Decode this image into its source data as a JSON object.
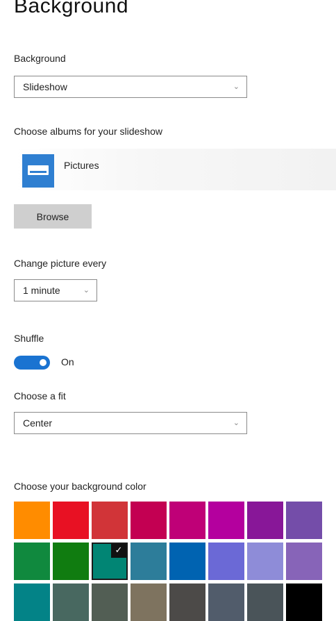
{
  "page": {
    "title": "Background"
  },
  "background": {
    "label": "Background",
    "value": "Slideshow"
  },
  "albums": {
    "label": "Choose albums for your slideshow",
    "items": [
      {
        "name": "Pictures",
        "icon": "folder-pictures-icon"
      }
    ]
  },
  "browse": {
    "label": "Browse"
  },
  "interval": {
    "label": "Change picture every",
    "value": "1 minute"
  },
  "shuffle": {
    "label": "Shuffle",
    "state": "On",
    "on": true
  },
  "fit": {
    "label": "Choose a fit",
    "value": "Center"
  },
  "color": {
    "label": "Choose your background color",
    "selected_index": 10,
    "swatches": [
      "#ff8c00",
      "#e81123",
      "#d13438",
      "#c30052",
      "#bf0077",
      "#b4009e",
      "#881798",
      "#744da9",
      "#10893e",
      "#107c10",
      "#018574",
      "#2d7d9a",
      "#0063b1",
      "#6b69d6",
      "#8e8cd8",
      "#8764b8",
      "#038387",
      "#486860",
      "#525e54",
      "#7e735f",
      "#4c4a48",
      "#515c6b",
      "#4a5459",
      "#000000"
    ]
  }
}
